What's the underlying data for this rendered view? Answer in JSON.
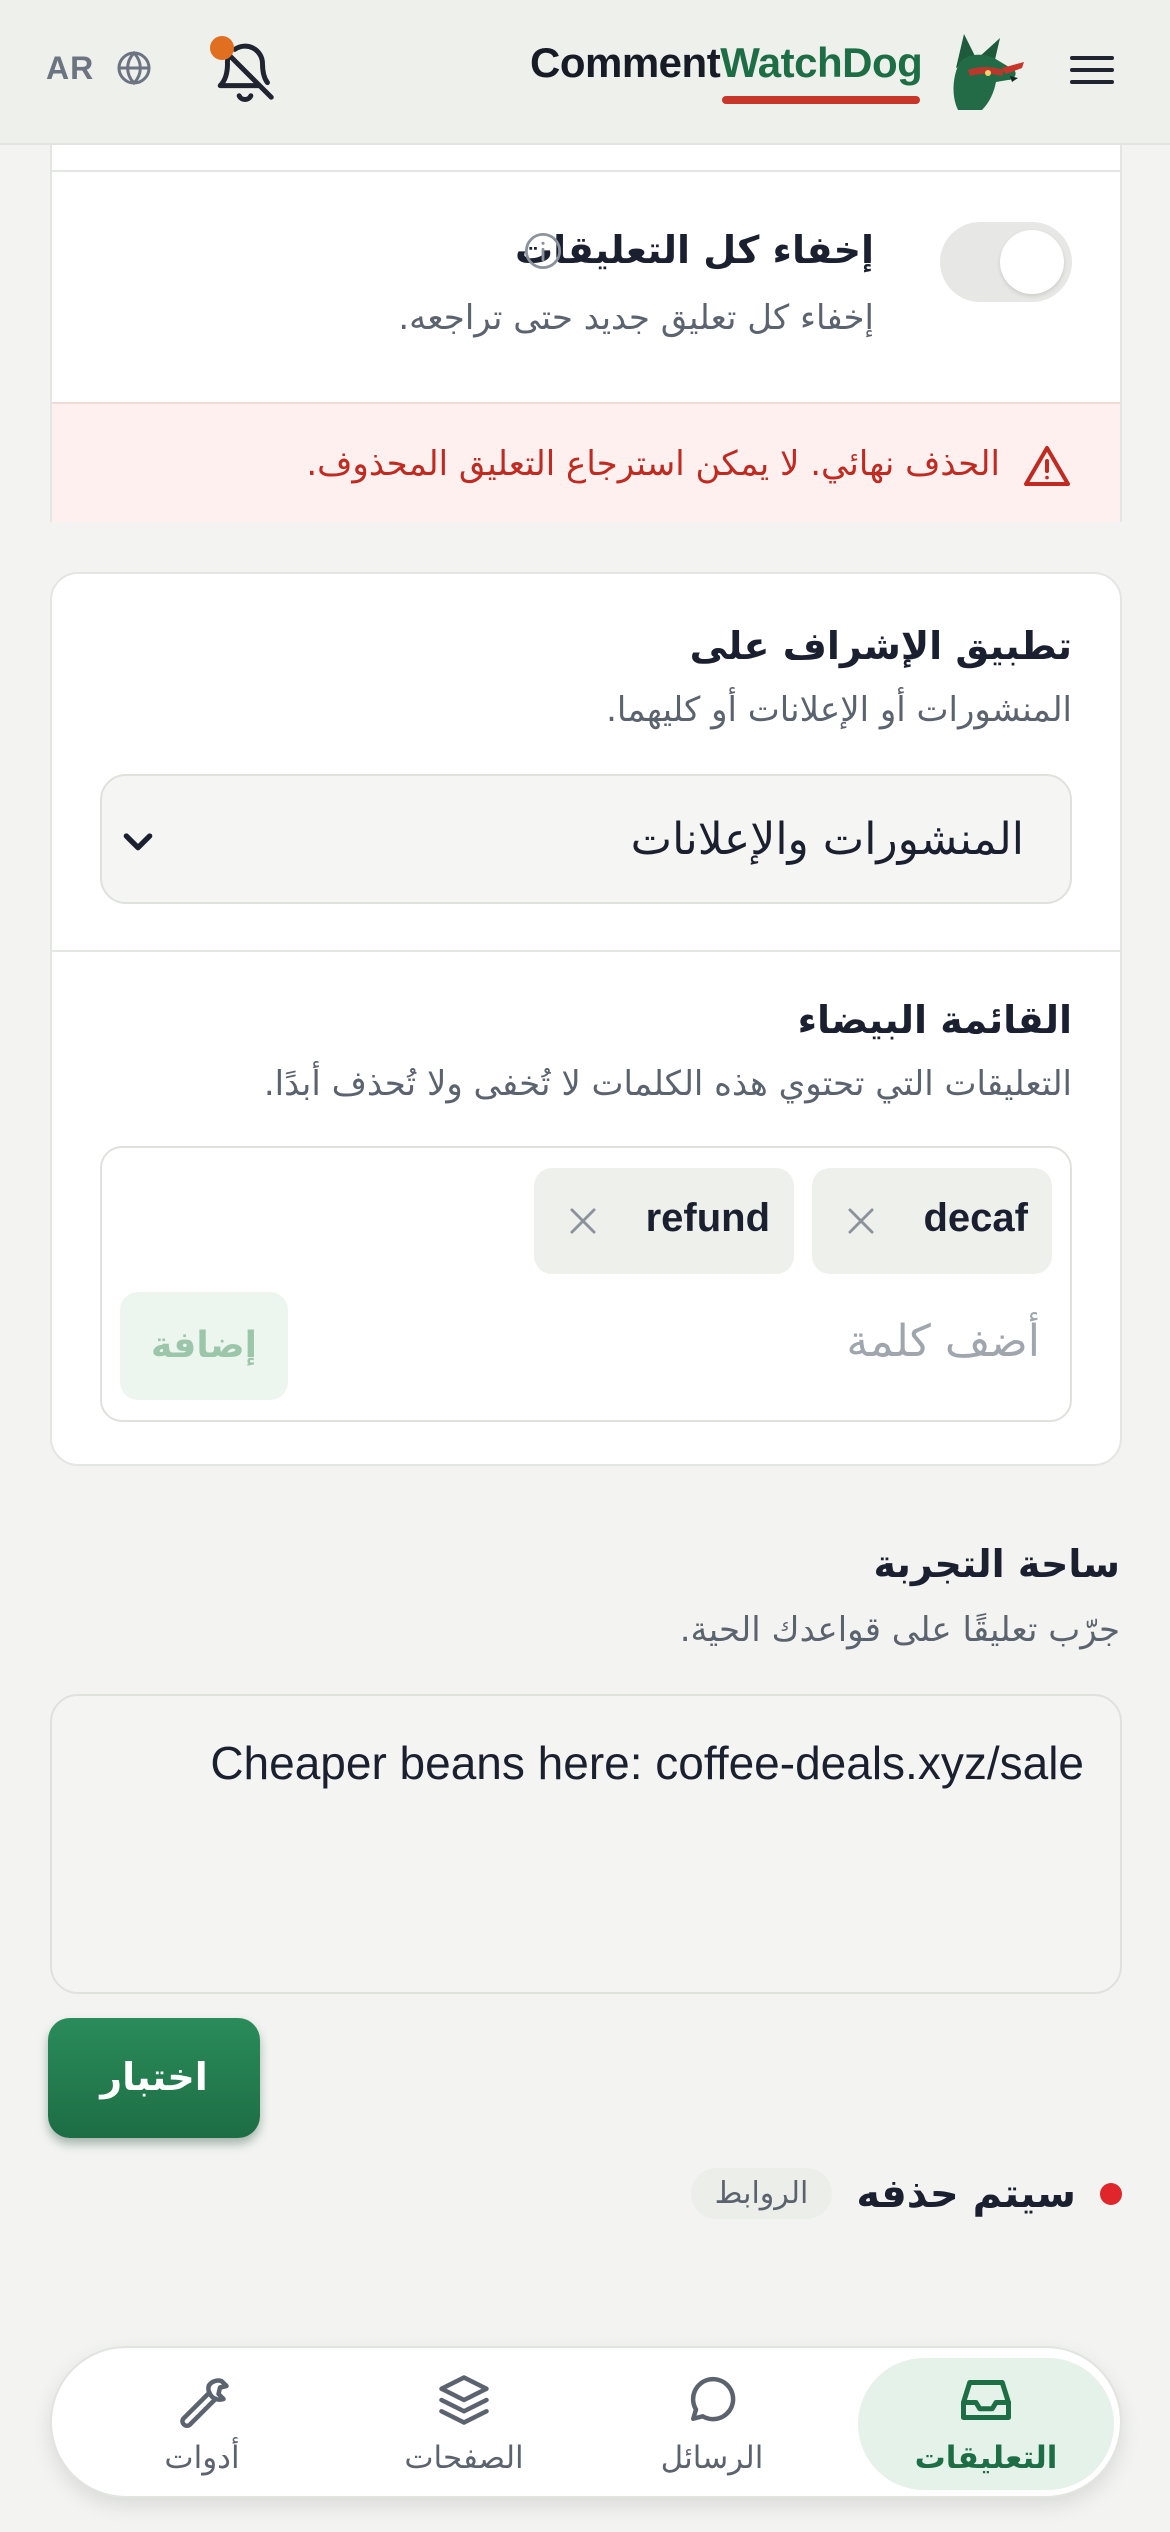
{
  "header": {
    "language_code": "AR",
    "brand_part1": "Comment",
    "brand_part2": "WatchDog"
  },
  "hide_all": {
    "title": "إخفاء كل التعليقات",
    "description": "إخفاء كل تعليق جديد حتى تراجعه.",
    "enabled": false
  },
  "warning": {
    "text": "الحذف نهائي. لا يمكن استرجاع التعليق المحذوف."
  },
  "apply_on": {
    "title": "تطبيق الإشراف على",
    "description": "المنشورات أو الإعلانات أو كليهما.",
    "selected": "المنشورات والإعلانات"
  },
  "whitelist": {
    "title": "القائمة البيضاء",
    "description": "التعليقات التي تحتوي هذه الكلمات لا تُخفى ولا تُحذف أبدًا.",
    "words": [
      "decaf",
      "refund"
    ],
    "input_placeholder": "أضف كلمة",
    "add_label": "إضافة"
  },
  "sandbox": {
    "title": "ساحة التجربة",
    "description": "جرّب تعليقًا على قواعدك الحية.",
    "input_value": "Cheaper beans here: coffee-deals.xyz/sale",
    "test_label": "اختبار",
    "result_text": "سيتم حذفه",
    "result_reason": "الروابط"
  },
  "nav": {
    "items": [
      {
        "label": "التعليقات",
        "icon": "inbox-icon",
        "active": true
      },
      {
        "label": "الرسائل",
        "icon": "chat-bubble-icon",
        "active": false
      },
      {
        "label": "الصفحات",
        "icon": "layers-icon",
        "active": false
      },
      {
        "label": "أدوات",
        "icon": "wrench-icon",
        "active": false
      }
    ]
  },
  "colors": {
    "brand_green": "#1e6e45",
    "danger_red": "#c02a20",
    "notification_dot": "#e0701f"
  }
}
